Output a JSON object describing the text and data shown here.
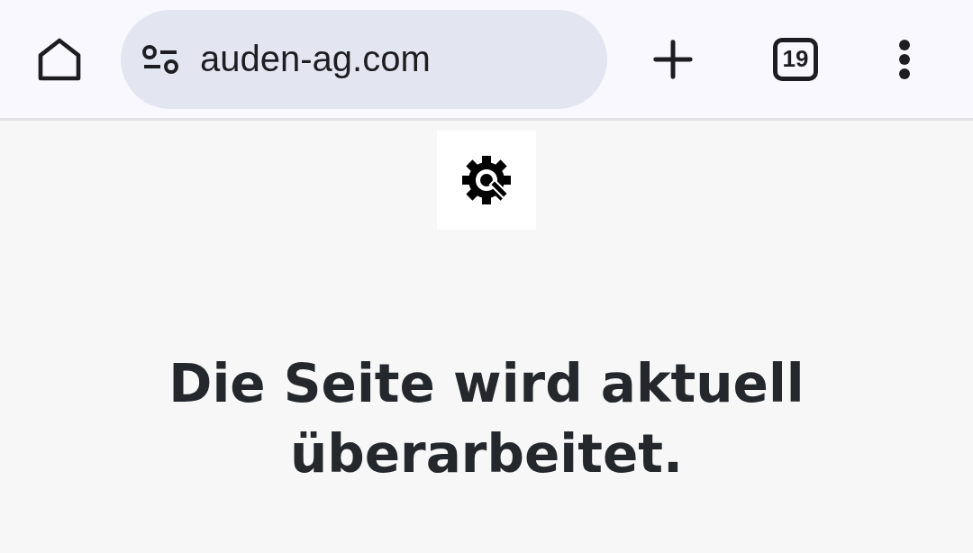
{
  "toolbar": {
    "url": "auden-ag.com",
    "tab_count": "19"
  },
  "page": {
    "heading": "Die Seite wird aktuell überarbeitet."
  }
}
